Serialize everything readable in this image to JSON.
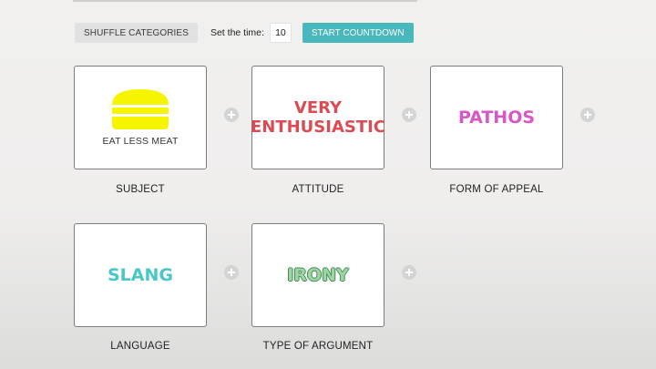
{
  "controls": {
    "shuffle_label": "SHUFFLE CATEGORIES",
    "time_label": "Set the time:",
    "time_value": "10",
    "start_label": "START COUNTDOWN"
  },
  "cards": [
    {
      "category": "SUBJECT",
      "value": "EAT LESS MEAT",
      "icon": "burger-icon"
    },
    {
      "category": "ATTITUDE",
      "value_line1": "VERY",
      "value_line2": "ENTHUSIASTIC",
      "color": "#dd4b52"
    },
    {
      "category": "FORM OF APPEAL",
      "value": "PATHOS",
      "color": "#d957c5"
    },
    {
      "category": "LANGUAGE",
      "value": "SLANG",
      "color": "#49c7c8"
    },
    {
      "category": "TYPE OF ARGUMENT",
      "value": "IRONY",
      "color": "#3d8d54"
    }
  ],
  "icons": {
    "add": "plus-circle-icon",
    "subject": "burger-icon"
  },
  "colors": {
    "accent": "#48b8bd",
    "burger": "#f5f500"
  }
}
